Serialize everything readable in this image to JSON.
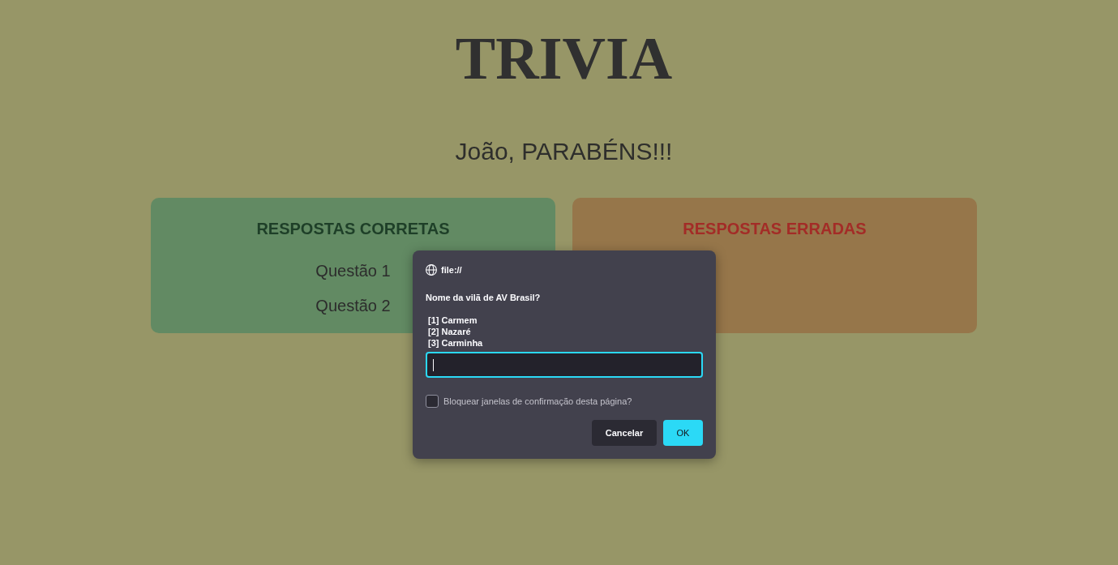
{
  "page": {
    "title": "TRIVIA",
    "greeting": "João, PARABÉNS!!!",
    "cards": [
      {
        "kind": "correct",
        "title": "RESPOSTAS CORRETAS",
        "items": [
          "Questão 1",
          "Questão 2"
        ]
      },
      {
        "kind": "wrong",
        "title": "RESPOSTAS ERRADAS"
      }
    ]
  },
  "dialog": {
    "origin": "file://",
    "message": "Nome da vilã de AV Brasil?",
    "options": [
      "[1] Carmem",
      "[2] Nazaré",
      "[3] Carminha"
    ],
    "input": {
      "focused": true
    },
    "checkbox": {
      "label": "Bloquear janelas de confirmação desta página?",
      "checked": false
    },
    "buttons": [
      {
        "kind": "secondary",
        "label": "Cancelar"
      },
      {
        "kind": "primary",
        "label": "OK"
      }
    ]
  }
}
